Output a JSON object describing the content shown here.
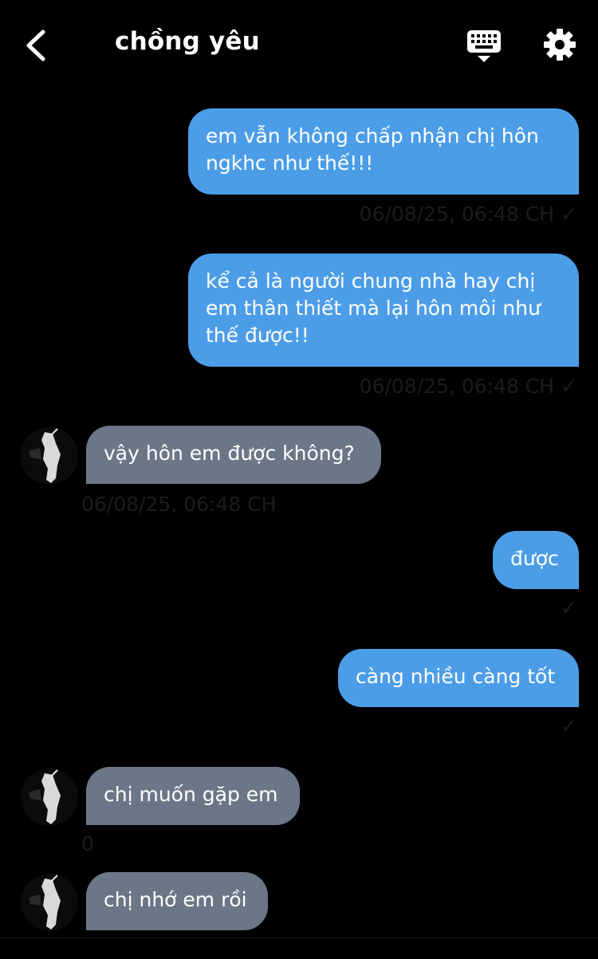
{
  "header": {
    "title": "chồng yêu",
    "back_icon": "chevron-left-icon",
    "keyboard_icon": "keyboard-icon",
    "settings_icon": "gear-icon"
  },
  "colors": {
    "background": "#000000",
    "outgoing_bubble": "#4c9de8",
    "incoming_bubble": "#6b7786",
    "text": "#ffffff",
    "meta_text": "#1c1c1c"
  },
  "messages": [
    {
      "direction": "out",
      "text": "em vẫn không chấp nhận chị hôn ngkhc như thế!!!",
      "meta": "06/08/25, 06:48 CH ✓"
    },
    {
      "direction": "out",
      "text": "kể cả là người chung nhà hay chị em thân thiết mà lại hôn môi như thế được!!",
      "meta": "06/08/25, 06:48 CH ✓"
    },
    {
      "direction": "in",
      "text": "vậy hôn em được không?",
      "meta": "06/08/25, 06:48 CH"
    },
    {
      "direction": "out",
      "text": "được",
      "meta": "✓"
    },
    {
      "direction": "out",
      "text": "càng nhiều càng tốt",
      "meta": "✓"
    },
    {
      "direction": "in",
      "text": "chị muốn gặp em",
      "meta": "0"
    },
    {
      "direction": "in",
      "text": "chị nhớ em rồi",
      "meta": ""
    }
  ]
}
